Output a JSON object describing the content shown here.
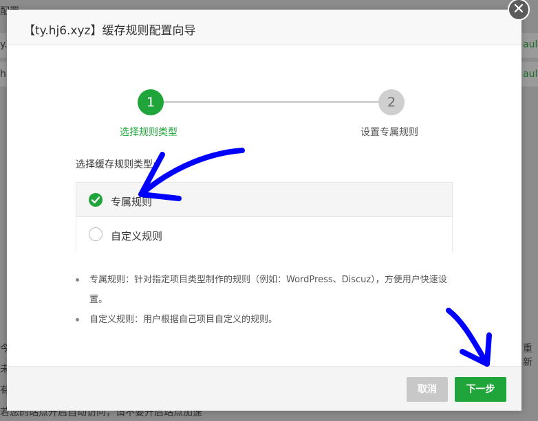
{
  "background": {
    "fragments": [
      "y.h",
      "h",
      "ault",
      "ault",
      "今",
      "未",
      "有",
      "若您的站点开启自动访问，请不要开启站点加速",
      "重新",
      "配置"
    ]
  },
  "dialog": {
    "title": "【ty.hj6.xyz】缓存规则配置向导",
    "close_symbol": "✕"
  },
  "stepper": {
    "steps": [
      {
        "number": "1",
        "label": "选择规则类型",
        "state": "active"
      },
      {
        "number": "2",
        "label": "设置专属规则",
        "state": "pending"
      }
    ]
  },
  "form": {
    "section_label": "选择缓存规则类型:",
    "options": [
      {
        "label": "专属规则",
        "selected": true
      },
      {
        "label": "自定义规则",
        "selected": false
      }
    ]
  },
  "notes": [
    "专属规则：针对指定项目类型制作的规则（例如：WordPress、Discuz），方便用户快速设置。",
    "自定义规则：用户根据自己项目自定义的规则。"
  ],
  "footer": {
    "cancel_label": "取消",
    "next_label": "下一步"
  },
  "colors": {
    "accent": "#20a53a",
    "annotation": "#0000ff",
    "overlay": "#8c8c8c"
  }
}
